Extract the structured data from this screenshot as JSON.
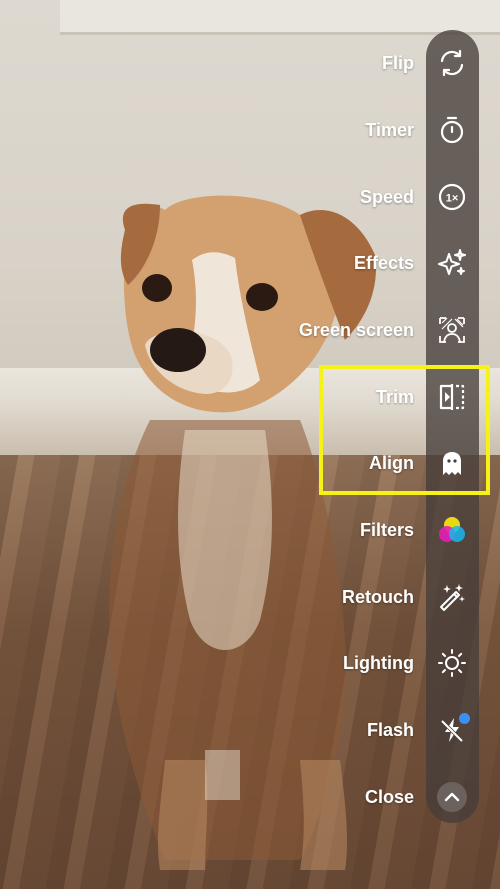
{
  "menu": {
    "items": [
      {
        "id": "flip",
        "label": "Flip",
        "icon": "flip-icon"
      },
      {
        "id": "timer",
        "label": "Timer",
        "icon": "timer-icon"
      },
      {
        "id": "speed",
        "label": "Speed",
        "icon": "speed-icon",
        "icon_text": "1×"
      },
      {
        "id": "effects",
        "label": "Effects",
        "icon": "sparkles-icon"
      },
      {
        "id": "green-screen",
        "label": "Green screen",
        "icon": "green-screen-icon"
      },
      {
        "id": "trim",
        "label": "Trim",
        "icon": "trim-icon"
      },
      {
        "id": "align",
        "label": "Align",
        "icon": "ghost-icon"
      },
      {
        "id": "filters",
        "label": "Filters",
        "icon": "filters-icon"
      },
      {
        "id": "retouch",
        "label": "Retouch",
        "icon": "magic-wand-icon"
      },
      {
        "id": "lighting",
        "label": "Lighting",
        "icon": "sun-icon"
      },
      {
        "id": "flash",
        "label": "Flash",
        "icon": "flash-off-icon"
      },
      {
        "id": "close",
        "label": "Close",
        "icon": "chevron-up-icon"
      }
    ]
  },
  "colors": {
    "highlight": "#f6f218",
    "panel": "#463e3a",
    "notification_dot": "#3b8ff5",
    "filters": [
      "#f2e012",
      "#e21fb5",
      "#17b6f0"
    ]
  }
}
